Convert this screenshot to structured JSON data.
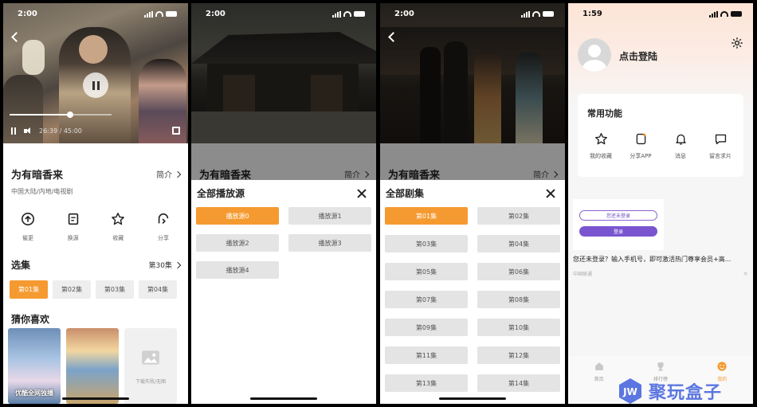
{
  "status": {
    "time_1": "2:00",
    "time_2": "2:00",
    "time_3": "2:00",
    "time_4": "1:59"
  },
  "player": {
    "time_display": "26:39 / 45:00",
    "progress": 0.59
  },
  "detail": {
    "title": "为有暗香来",
    "intro_label": "简介",
    "meta": "中国大陆/内地/电视剧",
    "actions": [
      {
        "label": "催更",
        "icon": "upload-circle-icon"
      },
      {
        "label": "换源",
        "icon": "switch-source-icon"
      },
      {
        "label": "收藏",
        "icon": "star-icon"
      },
      {
        "label": "分享",
        "icon": "share-icon"
      }
    ],
    "episodes_heading": "选集",
    "episodes_count": "第30集",
    "episodes": [
      "第01集",
      "第02集",
      "第03集",
      "第04集"
    ],
    "active_episode": 0,
    "recommend_heading": "猜你喜欢",
    "recommends": [
      {
        "caption": "优酷全网独播"
      },
      {
        "caption": ""
      },
      {
        "caption": "下载失败/无图"
      }
    ]
  },
  "sources_sheet": {
    "title": "全部播放源",
    "sources": [
      "播放源0",
      "播放源1",
      "播放源2",
      "播放源3",
      "播放源4"
    ],
    "active": 0
  },
  "episodes_sheet": {
    "title": "全部剧集",
    "episodes": [
      "第01集",
      "第02集",
      "第03集",
      "第04集",
      "第05集",
      "第06集",
      "第07集",
      "第08集",
      "第09集",
      "第10集",
      "第11集",
      "第12集",
      "第13集",
      "第14集"
    ],
    "active": 0
  },
  "profile": {
    "login_text": "点击登陆",
    "card_title": "常用功能",
    "features": [
      {
        "label": "我的收藏",
        "icon": "star-icon"
      },
      {
        "label": "分享APP",
        "icon": "share-app-icon"
      },
      {
        "label": "消息",
        "icon": "bell-icon"
      },
      {
        "label": "留言求片",
        "icon": "message-icon"
      }
    ],
    "ad": {
      "pill_outline": "您还未登录",
      "pill_fill": "登录",
      "text": "您还未登录？输入手机号，即可激活热门尊享会员+高...",
      "source": "中国联通",
      "close": "×"
    },
    "tabs": [
      {
        "label": "首页",
        "icon": "home-icon"
      },
      {
        "label": "排行榜",
        "icon": "trophy-icon"
      },
      {
        "label": "我的",
        "icon": "smile-icon"
      }
    ],
    "active_tab": 2
  },
  "watermark": {
    "logo_text": "JW",
    "text": "聚玩盒子"
  },
  "colors": {
    "accent": "#f59a30",
    "ad_purple": "#7a55d0",
    "watermark_blue": "#5b76e0"
  }
}
